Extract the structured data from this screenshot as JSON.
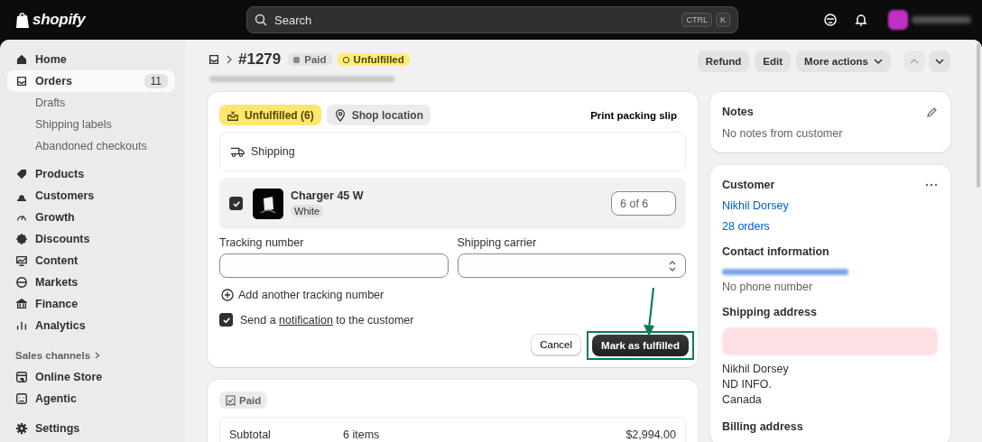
{
  "topbar": {
    "logo": "shopify",
    "search": {
      "placeholder": "Search",
      "keys": [
        "CTRL",
        "K"
      ]
    }
  },
  "sidebar": {
    "items": [
      {
        "label": "Home",
        "selected": false
      },
      {
        "label": "Orders",
        "badge": "11",
        "selected": true,
        "children": [
          {
            "label": "Drafts",
            "selected": false
          },
          {
            "label": "Shipping labels",
            "selected": false
          },
          {
            "label": "Abandoned checkouts",
            "selected": false
          }
        ]
      },
      {
        "label": "Products",
        "selected": false
      },
      {
        "label": "Customers",
        "selected": false
      },
      {
        "label": "Growth",
        "selected": false
      },
      {
        "label": "Discounts",
        "selected": false
      },
      {
        "label": "Content",
        "selected": false
      },
      {
        "label": "Markets",
        "selected": false
      },
      {
        "label": "Finance",
        "selected": false
      },
      {
        "label": "Analytics",
        "selected": false
      }
    ],
    "section": "Sales channels",
    "channels": [
      {
        "label": "Online Store",
        "selected": false
      },
      {
        "label": "Agentic",
        "selected": false
      }
    ],
    "settings": {
      "label": "Settings",
      "selected": false
    }
  },
  "order": {
    "number": "#1279",
    "badges": [
      {
        "label": "Paid",
        "kind": "neutral"
      },
      {
        "label": "Unfulfilled",
        "kind": "warning"
      }
    ],
    "actions": [
      "Refund",
      "Edit",
      "More actions"
    ]
  },
  "fulfillment": {
    "badges": [
      {
        "label": "Unfulfilled (6)",
        "kind": "warning"
      },
      {
        "label": "Shop location",
        "kind": "neutral"
      }
    ],
    "print": "Print packing slip",
    "method": "Shipping",
    "item": {
      "name": "Charger 45 W",
      "variant": "White",
      "checked": true,
      "quantity": "6 of 6"
    },
    "tracking_label": "Tracking number",
    "carrier_label": "Shipping carrier",
    "add_tracking": "Add another tracking number",
    "notify": {
      "checked": true,
      "before": "Send a",
      "link": "notification",
      "after": "to the customer"
    },
    "cancel": "Cancel",
    "submit": "Mark as fulfilled"
  },
  "payment": {
    "badge": "Paid",
    "rows": [
      {
        "label": "Subtotal",
        "detail": "6 items",
        "amount": "$2,994.00"
      }
    ]
  },
  "notes": {
    "title": "Notes",
    "text": "No notes from customer"
  },
  "customer": {
    "title": "Customer",
    "name": "Nikhil Dorsey",
    "orders": "28 orders",
    "contact_title": "Contact information",
    "phone": "No phone number",
    "shipping_title": "Shipping address",
    "address": [
      "Nikhil Dorsey",
      "ND INFO.",
      "Canada"
    ],
    "billing_title": "Billing address"
  }
}
